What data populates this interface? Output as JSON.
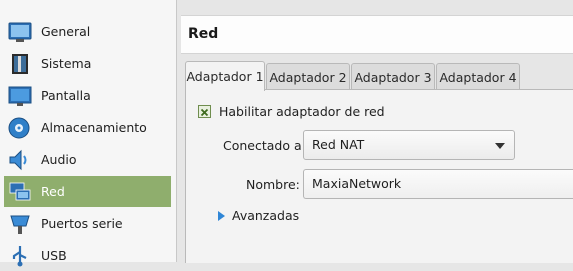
{
  "sidebar": {
    "items": [
      {
        "label": "General",
        "icon": "general-icon"
      },
      {
        "label": "Sistema",
        "icon": "system-icon"
      },
      {
        "label": "Pantalla",
        "icon": "display-icon"
      },
      {
        "label": "Almacenamiento",
        "icon": "storage-icon"
      },
      {
        "label": "Audio",
        "icon": "audio-icon"
      },
      {
        "label": "Red",
        "icon": "network-icon",
        "selected": true
      },
      {
        "label": "Puertos serie",
        "icon": "serial-ports-icon"
      },
      {
        "label": "USB",
        "icon": "usb-icon"
      }
    ],
    "selected_color": "#8fae6d"
  },
  "main": {
    "title": "Red",
    "tabs": [
      {
        "label": "Adaptador 1",
        "active": true
      },
      {
        "label": "Adaptador 2"
      },
      {
        "label": "Adaptador 3"
      },
      {
        "label": "Adaptador 4"
      }
    ],
    "enable_adapter": {
      "label": "Habilitar adaptador de red",
      "checked": true
    },
    "attached_to": {
      "label": "Conectado a:",
      "value": "Red NAT"
    },
    "name": {
      "label": "Nombre:",
      "value": "MaxiaNetwork"
    },
    "advanced": {
      "label": "Avanzadas"
    }
  }
}
